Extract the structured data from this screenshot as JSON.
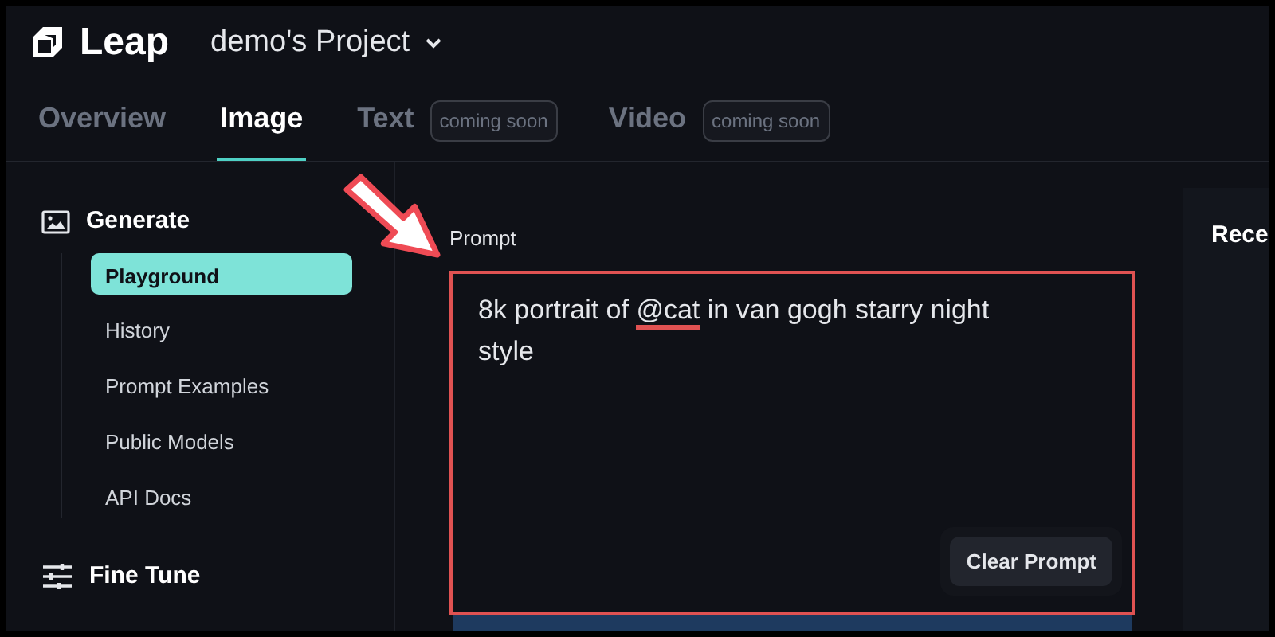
{
  "header": {
    "logo": "Leap",
    "project": "demo's Project"
  },
  "tabs": [
    {
      "label": "Overview",
      "selected": false
    },
    {
      "label": "Image",
      "selected": true
    },
    {
      "label": "Text",
      "selected": false,
      "badge": "coming soon"
    },
    {
      "label": "Video",
      "selected": false,
      "badge": "coming soon"
    }
  ],
  "sidebar": {
    "sections": [
      {
        "title": "Generate",
        "kind": "image",
        "items": [
          {
            "label": "Playground",
            "selected": true
          },
          {
            "label": "History",
            "selected": false
          },
          {
            "label": "Prompt Examples",
            "selected": false
          },
          {
            "label": "Public Models",
            "selected": false
          },
          {
            "label": "API Docs",
            "selected": false
          }
        ]
      },
      {
        "title": "Fine Tune",
        "kind": "sliders"
      }
    ]
  },
  "prompt": {
    "label": "Prompt",
    "value_parts": [
      {
        "text": "8k portrait of ",
        "marked": false
      },
      {
        "text": "@cat",
        "marked": true
      },
      {
        "text": " in van gogh starry night style",
        "marked": false
      }
    ],
    "clear_button": "Clear Prompt"
  },
  "recent_panel": {
    "title": "Rece"
  }
}
